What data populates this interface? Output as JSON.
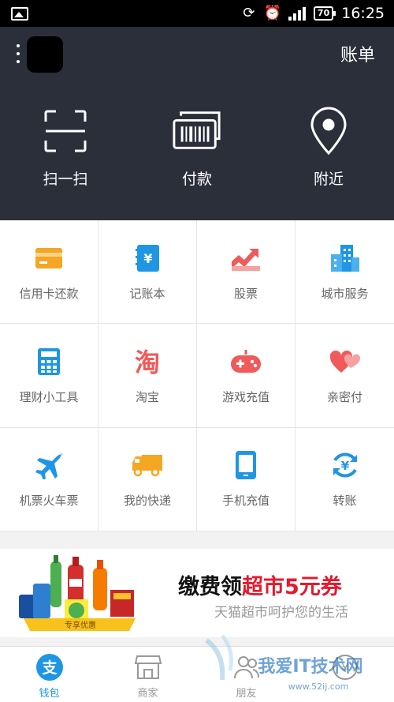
{
  "status_bar": {
    "time": "16:25",
    "battery": "70"
  },
  "header": {
    "bill_label": "账单",
    "quick_actions": [
      {
        "label": "扫一扫",
        "icon": "scan-icon"
      },
      {
        "label": "付款",
        "icon": "barcode-icon"
      },
      {
        "label": "附近",
        "icon": "location-pin-icon"
      }
    ]
  },
  "services": [
    {
      "label": "信用卡还款",
      "icon": "credit-card-icon",
      "color": "#f5a623"
    },
    {
      "label": "记账本",
      "icon": "ledger-icon",
      "color": "#1e96e3"
    },
    {
      "label": "股票",
      "icon": "stock-chart-icon",
      "color": "#f05a5a"
    },
    {
      "label": "城市服务",
      "icon": "city-buildings-icon",
      "color": "#1e96e3"
    },
    {
      "label": "理财小工具",
      "icon": "calculator-icon",
      "color": "#1e96e3"
    },
    {
      "label": "淘宝",
      "icon": "taobao-icon",
      "color": "#f05a5a"
    },
    {
      "label": "游戏充值",
      "icon": "gamepad-icon",
      "color": "#f05a5a"
    },
    {
      "label": "亲密付",
      "icon": "hearts-icon",
      "color": "#f05a5a"
    },
    {
      "label": "机票火车票",
      "icon": "airplane-icon",
      "color": "#1e96e3"
    },
    {
      "label": "我的快递",
      "icon": "delivery-truck-icon",
      "color": "#f5a623"
    },
    {
      "label": "手机充值",
      "icon": "mobile-phone-icon",
      "color": "#1e96e3"
    },
    {
      "label": "转账",
      "icon": "transfer-icon",
      "color": "#1e96e3"
    }
  ],
  "banner": {
    "title_prefix": "缴费领",
    "title_highlight": "超市5元券",
    "subtitle": "天猫超市呵护您的生活",
    "badge": "专享优惠"
  },
  "tabs": [
    {
      "label": "钱包",
      "icon": "wallet-alipay-icon",
      "active": true
    },
    {
      "label": "商家",
      "icon": "storefront-icon",
      "active": false
    },
    {
      "label": "朋友",
      "icon": "friends-icon",
      "active": false
    },
    {
      "label": "",
      "icon": "money-icon",
      "active": false
    }
  ],
  "watermark": {
    "text": "我爱IT技术网",
    "url": "www.52ij.com"
  },
  "colors": {
    "header_bg": "#2b2f3a",
    "accent_blue": "#1e96e3",
    "promo_red": "#e8192c"
  }
}
